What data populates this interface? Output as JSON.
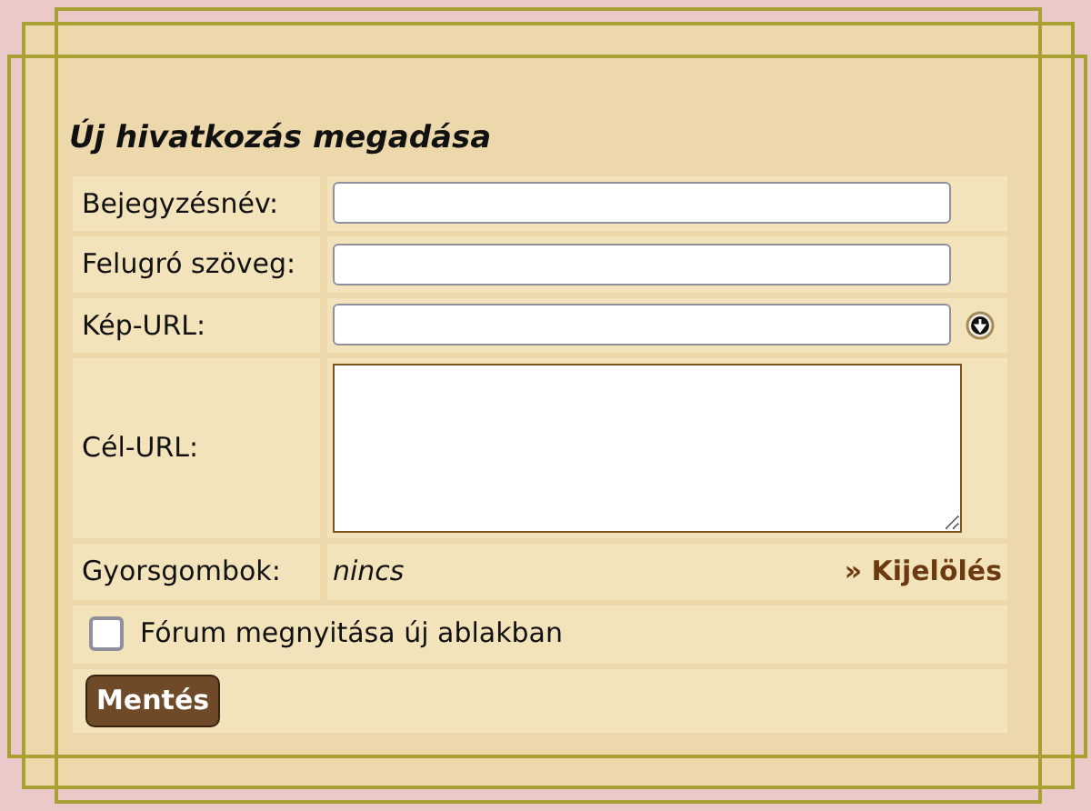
{
  "form": {
    "title": "Új hivatkozás megadása",
    "rows": [
      {
        "kind": "input",
        "label": "Bejegyzésnév:"
      },
      {
        "kind": "input",
        "label": "Felugró szöveg:"
      },
      {
        "kind": "input_icon",
        "label": "Kép-URL:"
      },
      {
        "kind": "textarea",
        "label": "Cél-URL:"
      },
      {
        "kind": "text_link",
        "label": "Gyorsgombok:",
        "value": "nincs",
        "link": "» Kijelölés"
      }
    ],
    "checkbox": {
      "label": "Fórum megnyitása új ablakban",
      "checked": false
    },
    "save_button": "Mentés"
  }
}
